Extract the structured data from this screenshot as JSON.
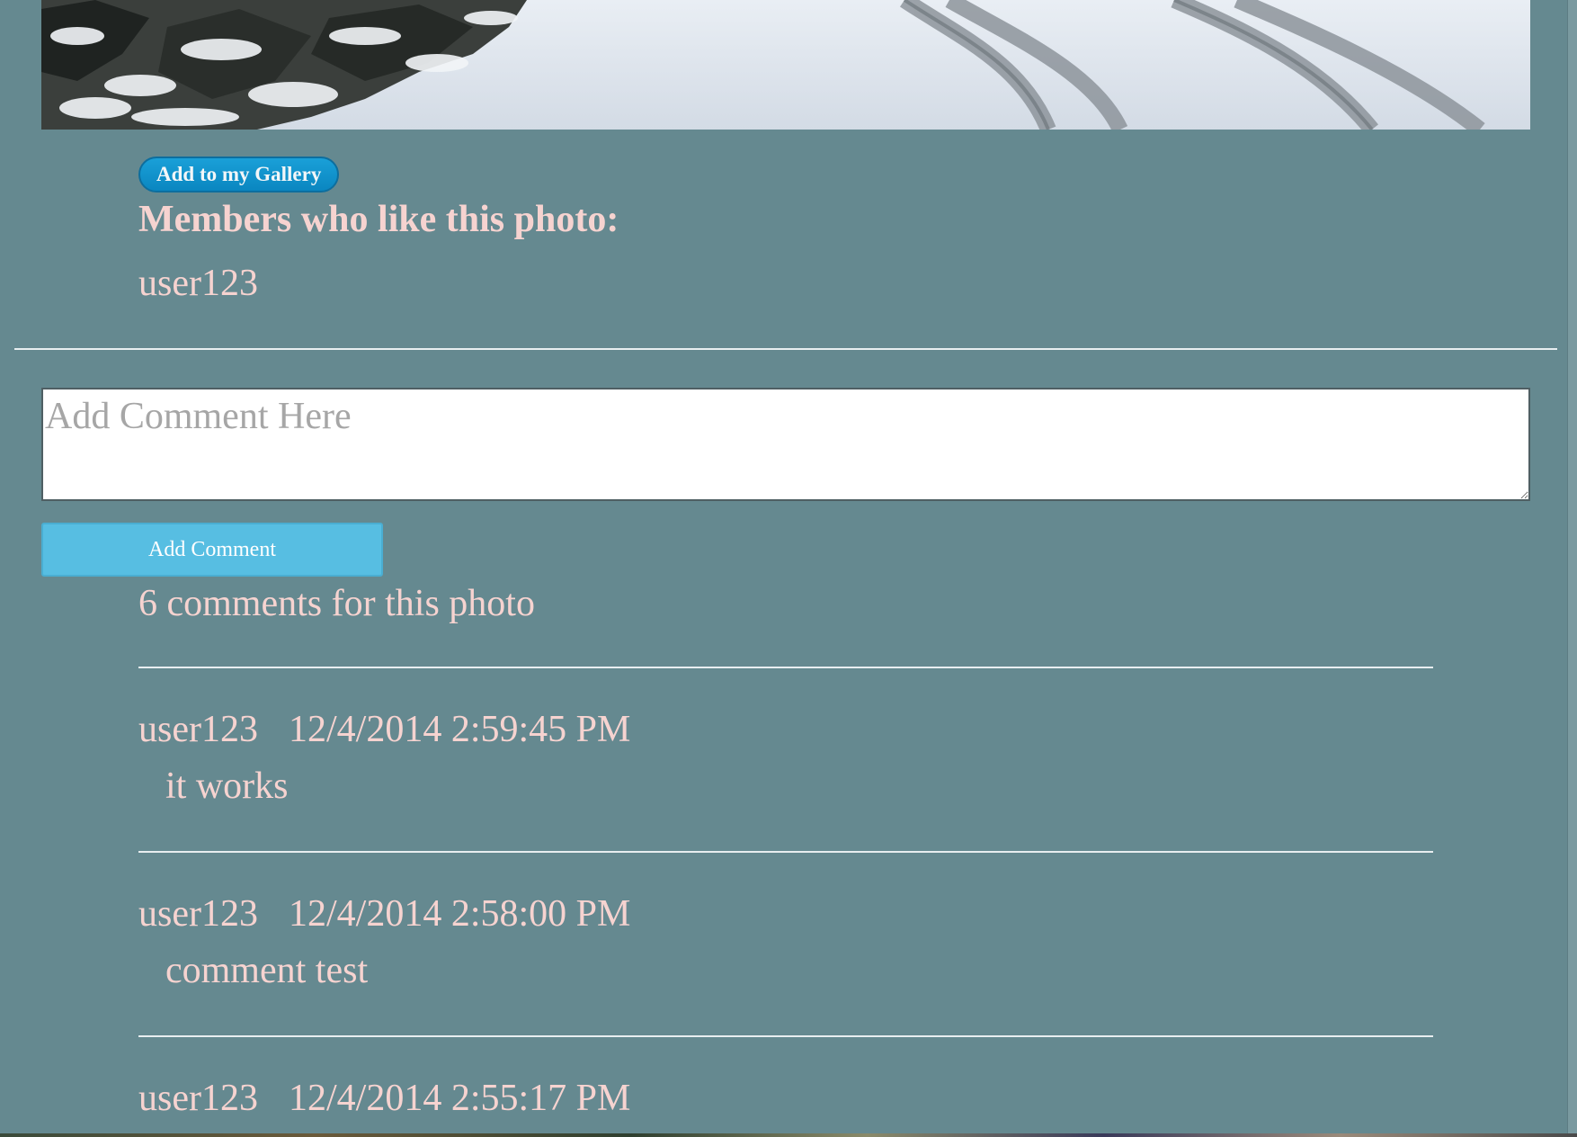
{
  "photo": {
    "subject": "snow-covered road with tire tracks"
  },
  "actions": {
    "add_to_gallery_label": "Add to my Gallery"
  },
  "likes": {
    "heading": "Members who like this photo:",
    "members": [
      "user123"
    ]
  },
  "comment_form": {
    "placeholder": "Add Comment Here",
    "value": "",
    "submit_label": "Add Comment"
  },
  "comments": {
    "count_text": "6 comments for this photo",
    "items": [
      {
        "user": "user123",
        "date": "12/4/2014 2:59:45 PM",
        "text": "it works"
      },
      {
        "user": "user123",
        "date": "12/4/2014 2:58:00 PM",
        "text": "comment test"
      },
      {
        "user": "user123",
        "date": "12/4/2014 2:55:17 PM",
        "text": ""
      }
    ]
  },
  "colors": {
    "page_background": "#658990",
    "text_pink": "#f6d3d0",
    "gallery_button": "#0a86c0",
    "add_comment_button": "#57bee2",
    "divider": "#e8eef0"
  }
}
